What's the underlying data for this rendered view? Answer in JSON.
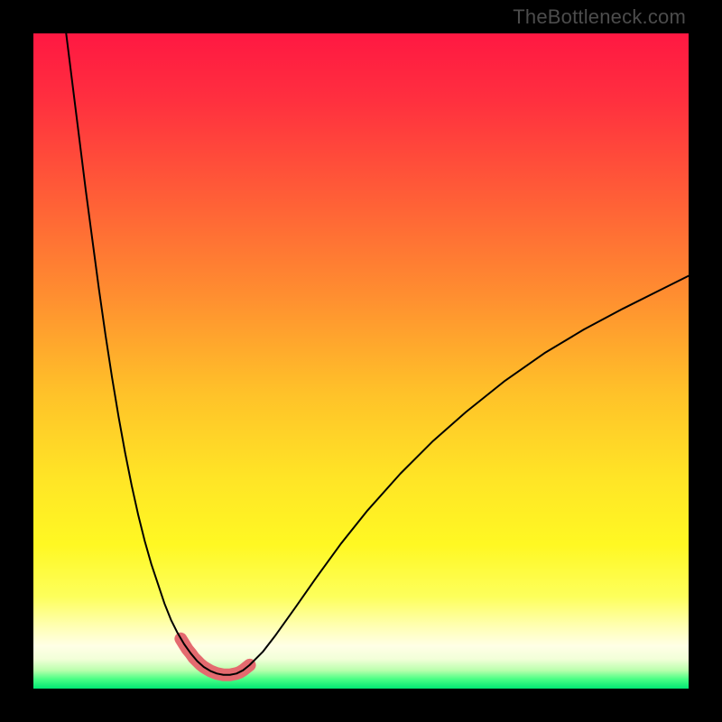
{
  "watermark": "TheBottleneck.com",
  "gradient": {
    "stops": [
      {
        "offset": 0.0,
        "color": "#ff1842"
      },
      {
        "offset": 0.1,
        "color": "#ff2f3f"
      },
      {
        "offset": 0.25,
        "color": "#ff5e37"
      },
      {
        "offset": 0.4,
        "color": "#ff8e30"
      },
      {
        "offset": 0.55,
        "color": "#ffc229"
      },
      {
        "offset": 0.68,
        "color": "#ffe526"
      },
      {
        "offset": 0.78,
        "color": "#fff823"
      },
      {
        "offset": 0.86,
        "color": "#fdff5c"
      },
      {
        "offset": 0.905,
        "color": "#ffffb3"
      },
      {
        "offset": 0.935,
        "color": "#ffffe6"
      },
      {
        "offset": 0.955,
        "color": "#f2ffd8"
      },
      {
        "offset": 0.972,
        "color": "#baffad"
      },
      {
        "offset": 0.985,
        "color": "#4dff86"
      },
      {
        "offset": 1.0,
        "color": "#00e673"
      }
    ]
  },
  "chart_data": {
    "type": "line",
    "title": "",
    "xlabel": "",
    "ylabel": "",
    "xlim": [
      0,
      100
    ],
    "ylim": [
      0,
      100
    ],
    "x": [
      5,
      6,
      7,
      8,
      9,
      10,
      11,
      12,
      13,
      14,
      15,
      16,
      17,
      18,
      19,
      20,
      21,
      22,
      23,
      24,
      25,
      26,
      27,
      28,
      29,
      30,
      31,
      32,
      33,
      35,
      37,
      40,
      43,
      47,
      51,
      56,
      61,
      66,
      72,
      78,
      84,
      90,
      96,
      100
    ],
    "values": [
      100,
      92,
      84,
      76,
      68.5,
      61,
      54,
      47.5,
      41.5,
      36,
      31,
      26.5,
      22.5,
      19,
      16,
      13,
      10.5,
      8.5,
      6.8,
      5.4,
      4.2,
      3.3,
      2.7,
      2.3,
      2.1,
      2.1,
      2.3,
      2.8,
      3.6,
      5.6,
      8.2,
      12.4,
      16.7,
      22.2,
      27.2,
      32.8,
      37.8,
      42.2,
      47,
      51.2,
      54.8,
      58,
      61,
      63
    ],
    "series": [
      {
        "name": "bottleneck-curve",
        "color": "#000000",
        "stroke_width": 2
      }
    ],
    "highlight": {
      "name": "valley-highlight",
      "color": "#e46a6f",
      "stroke_width": 14,
      "x": [
        22.5,
        23,
        23.5,
        24,
        24.5,
        25,
        25.5,
        26,
        26.5,
        27,
        27.5,
        28,
        28.5,
        29,
        29.5,
        30,
        30.5,
        31,
        31.5,
        32,
        32.5,
        33
      ],
      "values": [
        7.6,
        6.8,
        6.0,
        5.4,
        4.7,
        4.2,
        3.7,
        3.3,
        3.0,
        2.7,
        2.5,
        2.3,
        2.2,
        2.1,
        2.1,
        2.1,
        2.2,
        2.3,
        2.5,
        2.8,
        3.2,
        3.6
      ]
    }
  }
}
